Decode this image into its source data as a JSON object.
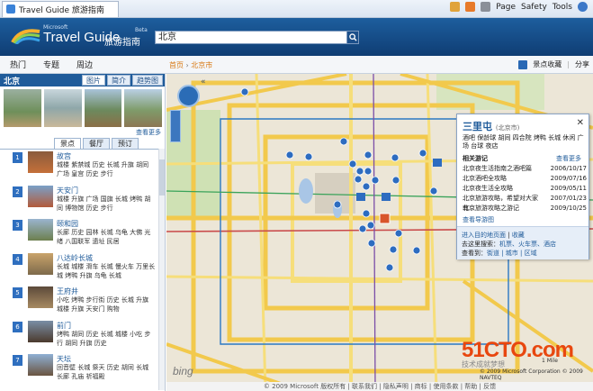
{
  "browser": {
    "tab_title": "Travel Guide 旅游指南",
    "tools": [
      "Page",
      "Safety",
      "Tools"
    ]
  },
  "header": {
    "ms": "Microsoft",
    "title": "Travel Guide",
    "title_cn": "旅游指南",
    "beta": "Beta",
    "search_value": "北京"
  },
  "nav": {
    "items": [
      "热门",
      "专题",
      "周边"
    ],
    "crumb_home": "首页",
    "crumb_city": "北京市",
    "fav": "景点收藏",
    "share": "分享"
  },
  "left": {
    "city": "北京",
    "city_tabs": [
      "图片",
      "简介",
      "趋势图"
    ],
    "more_pics": "查看更多",
    "sight_tabs": [
      "景点",
      "餐厅",
      "预订"
    ],
    "items": [
      {
        "num": "1",
        "name": "故宫",
        "tags": "城楼 紫禁城 历史 长城 升旗 胡同 广场 皇宫 历史 步行"
      },
      {
        "num": "2",
        "name": "天安门",
        "tags": "城楼 升旗 广场 国旗 长城 烤鸭 胡同 博物馆 历史 步行"
      },
      {
        "num": "3",
        "name": "颐和园",
        "tags": "长廊 历史 园林 长城 乌龟 大佛 光绪 八国联军 遗址 民居"
      },
      {
        "num": "4",
        "name": "八达岭长城",
        "tags": "长城 城楼 滑车 长城 慢火车 万里长城 烤鸭 升旗 乌龟 长城"
      },
      {
        "num": "5",
        "name": "王府井",
        "tags": "小吃 烤鸭 步行街 历史 长城 升旗 城楼 升旗 天安门 购物"
      },
      {
        "num": "6",
        "name": "前门",
        "tags": "烤鸭 胡同 历史 长城 城楼 小吃 步行 胡同 升旗 历史"
      },
      {
        "num": "7",
        "name": "天坛",
        "tags": "回音壁 长城 祭天 历史 胡同 长城 长廊 孔庙 祈福殿"
      }
    ]
  },
  "popup": {
    "title": "三里屯",
    "subtitle": "(北京市)",
    "tags": "酒吧 保龄球 胡同 四合院 烤鸭 长城 休闲 广场 台球 夜店",
    "section": "相关游记",
    "more": "查看更多",
    "rows": [
      {
        "t": "北京夜生活指南之酒吧篇",
        "d": "2006/10/17"
      },
      {
        "t": "北京酒吧全攻略",
        "d": "2009/07/16"
      },
      {
        "t": "北京夜生活全攻略",
        "d": "2009/05/11"
      },
      {
        "t": "北京旅游攻略，希望对大家有...",
        "d": "2007/01/23"
      },
      {
        "t": "北京旅游攻略之游记",
        "d": "2009/10/25"
      }
    ],
    "tip": "查看导游图",
    "foot_line1a": "进入目的地页面",
    "foot_line1b": "收藏",
    "foot_line2a": "去这里搜索：",
    "foot_line2b": "机票、火车票、酒店",
    "foot_line3a": "查看到：",
    "foot_line3b": "街道 | 城市 | 区域"
  },
  "map": {
    "bing": "bing",
    "copyright": "© 2009 Microsoft Corporation  © 2009 NAVTEQ",
    "scale": "1 Mile"
  },
  "watermark": {
    "big": "51CTO.com",
    "small": "技术成就梦想"
  },
  "footer": "© 2009 Microsoft 版权所有 | 联系我们 | 隐私声明 | 商标 | 使用条款 | 帮助 | 反馈"
}
